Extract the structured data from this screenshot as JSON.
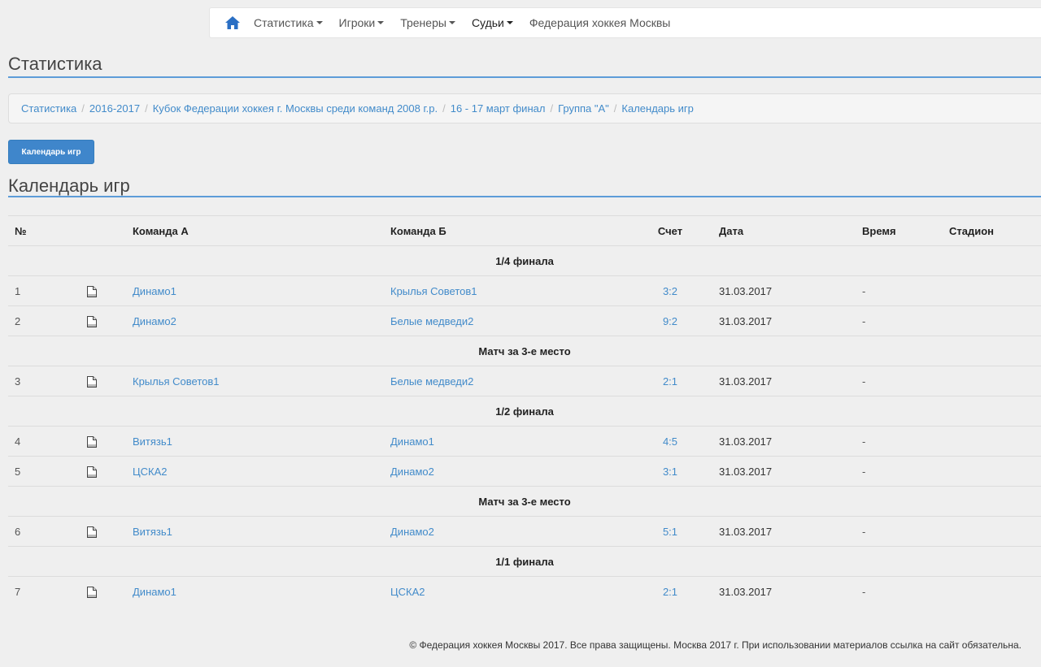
{
  "nav": {
    "items": [
      {
        "label": "Статистика",
        "caret": true
      },
      {
        "label": "Игроки",
        "caret": true
      },
      {
        "label": "Тренеры",
        "caret": true
      },
      {
        "label": "Судьи",
        "caret": true
      },
      {
        "label": "Федерация хоккея Москвы",
        "caret": false
      }
    ],
    "home_icon": "home-icon",
    "accent": "#2a6fc4"
  },
  "page_title": "Статистика",
  "breadcrumb": [
    "Статистика",
    "2016-2017",
    "Кубок Федерации хоккея г. Москвы среди команд 2008 г.р.",
    "16 - 17 март финал",
    "Группа \"А\"",
    "Календарь игр"
  ],
  "calendar_button": "Календарь игр",
  "section_title": "Календарь игр",
  "table": {
    "headers": {
      "num": "№",
      "icon": "",
      "team_a": "Команда А",
      "team_b": "Команда Б",
      "score": "Счет",
      "date": "Дата",
      "time": "Время",
      "stadium": "Стадион"
    },
    "stages": [
      {
        "title": "1/4 финала",
        "games": [
          {
            "num": "1",
            "team_a": "Динамо1",
            "team_b": "Крылья Советов1",
            "score": "3:2",
            "date": "31.03.2017",
            "time": "-",
            "stadium": ""
          },
          {
            "num": "2",
            "team_a": "Динамо2",
            "team_b": "Белые медведи2",
            "score": "9:2",
            "date": "31.03.2017",
            "time": "-",
            "stadium": ""
          }
        ]
      },
      {
        "title": "Матч за 3-е место",
        "games": [
          {
            "num": "3",
            "team_a": "Крылья Советов1",
            "team_b": "Белые медведи2",
            "score": "2:1",
            "date": "31.03.2017",
            "time": "-",
            "stadium": ""
          }
        ]
      },
      {
        "title": "1/2 финала",
        "games": [
          {
            "num": "4",
            "team_a": "Витязь1",
            "team_b": "Динамо1",
            "score": "4:5",
            "date": "31.03.2017",
            "time": "-",
            "stadium": ""
          },
          {
            "num": "5",
            "team_a": "ЦСКА2",
            "team_b": "Динамо2",
            "score": "3:1",
            "date": "31.03.2017",
            "time": "-",
            "stadium": ""
          }
        ]
      },
      {
        "title": "Матч за 3-е место",
        "games": [
          {
            "num": "6",
            "team_a": "Витязь1",
            "team_b": "Динамо2",
            "score": "5:1",
            "date": "31.03.2017",
            "time": "-",
            "stadium": ""
          }
        ]
      },
      {
        "title": "1/1 финала",
        "games": [
          {
            "num": "7",
            "team_a": "Динамо1",
            "team_b": "ЦСКА2",
            "score": "2:1",
            "date": "31.03.2017",
            "time": "-",
            "stadium": ""
          }
        ]
      }
    ]
  },
  "footer": "© Федерация хоккея Москвы 2017. Все права защищены. Москва 2017 г. При использовании материалов ссылка на сайт обязательна."
}
